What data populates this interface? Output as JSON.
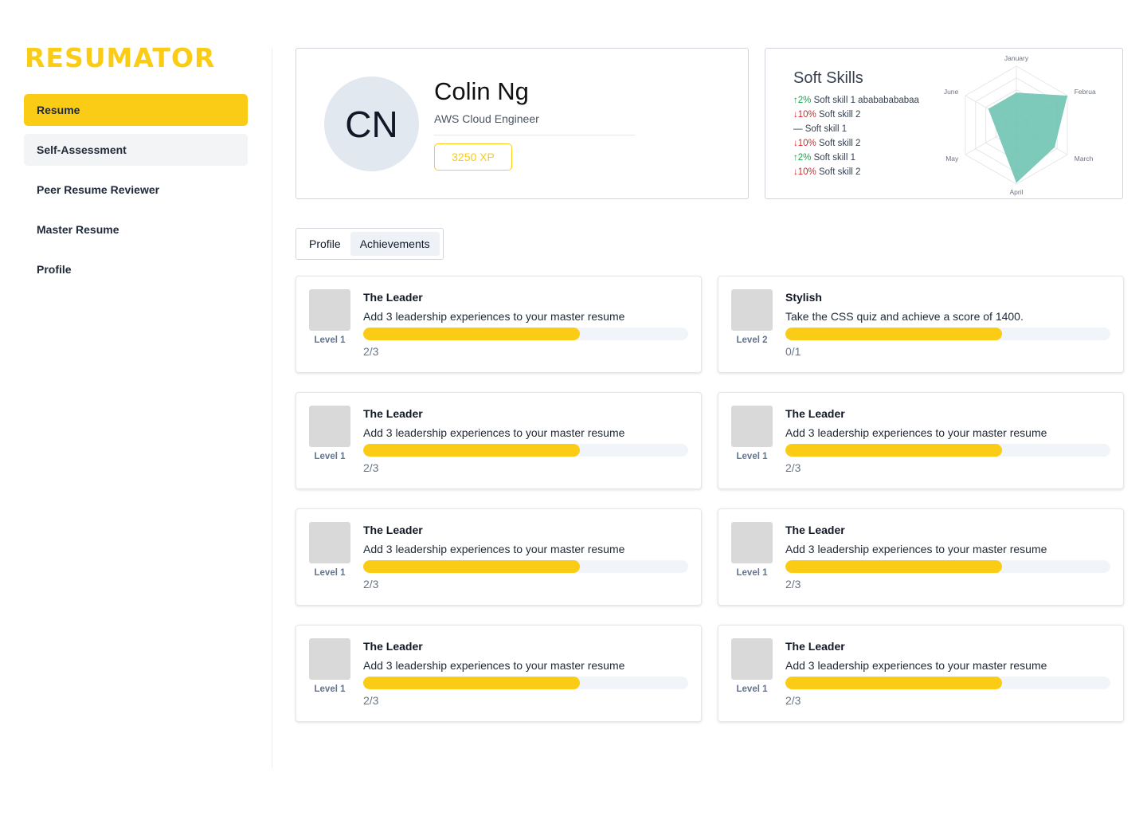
{
  "app": {
    "brand": "RESUMATOR"
  },
  "sidebar": {
    "items": [
      {
        "label": "Resume",
        "state": "active"
      },
      {
        "label": "Self-Assessment",
        "state": "hover"
      },
      {
        "label": "Peer Resume Reviewer",
        "state": ""
      },
      {
        "label": "Master Resume",
        "state": ""
      },
      {
        "label": "Profile",
        "state": ""
      }
    ]
  },
  "profile": {
    "initials": "CN",
    "name": "Colin Ng",
    "title": "AWS Cloud Engineer",
    "xp": "3250 XP"
  },
  "soft_skills": {
    "title": "Soft Skills",
    "items": [
      {
        "trend": "up",
        "arrow": "↑",
        "change": "2%",
        "label": "Soft skill 1 abababababaa"
      },
      {
        "trend": "down",
        "arrow": "↓",
        "change": "10%",
        "label": "Soft skill 2"
      },
      {
        "trend": "flat",
        "arrow": "—",
        "change": "",
        "label": "Soft skill 1"
      },
      {
        "trend": "down",
        "arrow": "↓",
        "change": "10%",
        "label": "Soft skill 2"
      },
      {
        "trend": "up",
        "arrow": "↑",
        "change": "2%",
        "label": "Soft skill 1"
      },
      {
        "trend": "down",
        "arrow": "↓",
        "change": "10%",
        "label": "Soft skill 2"
      }
    ],
    "colors": {
      "fill": "#6fc3b2",
      "grid": "#e5e7eb"
    }
  },
  "chart_data": {
    "type": "radar",
    "categories": [
      "January",
      "February",
      "March",
      "April",
      "May",
      "June"
    ],
    "series": [
      {
        "values": [
          0.55,
          1.0,
          0.75,
          0.98,
          0.35,
          0.55
        ]
      }
    ],
    "range": [
      0,
      1
    ],
    "grid": true
  },
  "tabs": [
    {
      "label": "Profile",
      "active": false
    },
    {
      "label": "Achievements",
      "active": true
    }
  ],
  "achievements": [
    {
      "name": "The Leader",
      "desc": "Add 3 leadership experiences to your master resume",
      "level": "Level 1",
      "count": "2/3",
      "progress": 0.667
    },
    {
      "name": "Stylish",
      "desc": "Take the CSS quiz and achieve a score of 1400.",
      "level": "Level 2",
      "count": "0/1",
      "progress": 0.667
    },
    {
      "name": "The Leader",
      "desc": "Add 3 leadership experiences to your master resume",
      "level": "Level 1",
      "count": "2/3",
      "progress": 0.667
    },
    {
      "name": "The Leader",
      "desc": "Add 3 leadership experiences to your master resume",
      "level": "Level 1",
      "count": "2/3",
      "progress": 0.667
    },
    {
      "name": "The Leader",
      "desc": "Add 3 leadership experiences to your master resume",
      "level": "Level 1",
      "count": "2/3",
      "progress": 0.667
    },
    {
      "name": "The Leader",
      "desc": "Add 3 leadership experiences to your master resume",
      "level": "Level 1",
      "count": "2/3",
      "progress": 0.667
    },
    {
      "name": "The Leader",
      "desc": "Add 3 leadership experiences to your master resume",
      "level": "Level 1",
      "count": "2/3",
      "progress": 0.667
    },
    {
      "name": "The Leader",
      "desc": "Add 3 leadership experiences to your master resume",
      "level": "Level 1",
      "count": "2/3",
      "progress": 0.667
    }
  ],
  "colors": {
    "accent": "#FACC15",
    "track": "#F1F5F9",
    "placeholder": "#D9D9D9"
  }
}
